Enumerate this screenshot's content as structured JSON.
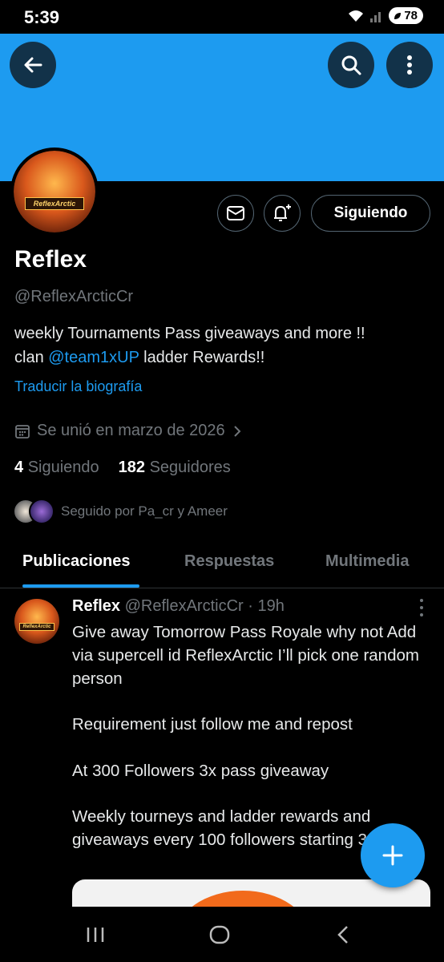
{
  "status_bar": {
    "time": "5:39",
    "battery": "78"
  },
  "header": {
    "back_icon": "arrow-left-icon",
    "search_icon": "search-icon",
    "more_icon": "more-vertical-icon"
  },
  "profile": {
    "avatar_badge": "ReflexArctic",
    "name": "Reflex",
    "handle": "@ReflexArcticCr",
    "bio_line1": "weekly Tournaments Pass giveaways and more !!",
    "bio_prefix": "clan ",
    "bio_mention": "@team1xUP",
    "bio_suffix": " ladder Rewards!!",
    "translate": "Traducir la biografía",
    "joined": "Se unió en marzo de 2026",
    "following_count": "4",
    "following_label": "Siguiendo",
    "followers_count": "182",
    "followers_label": "Seguidores",
    "followed_by": "Seguido por Pa_cr y Ameer"
  },
  "actions": {
    "message_icon": "envelope-icon",
    "notify_icon": "bell-plus-icon",
    "follow_label": "Siguiendo"
  },
  "tabs": [
    {
      "label": "Publicaciones",
      "active": true
    },
    {
      "label": "Respuestas",
      "active": false
    },
    {
      "label": "Multimedia",
      "active": false
    }
  ],
  "post": {
    "author": "Reflex",
    "handle": "@ReflexArcticCr",
    "time": "· 19h",
    "avatar_badge": "ReflexArctic",
    "text": "Give away Tomorrow Pass Royale why not Add via supercell id ReflexArctic I’ll pick one random person\n\nRequirement just follow me and repost\n\nAt 300 Followers 3x pass giveaway\n\nWeekly tourneys and ladder rewards and giveaways every 100 followers starting 300"
  },
  "fab": {
    "icon": "plus-icon"
  },
  "nav": {
    "recents_icon": "recents-icon",
    "home_icon": "home-icon",
    "back_icon": "back-chevron-icon"
  },
  "colors": {
    "accent": "#1d9bf0",
    "background": "#000000",
    "muted": "#71767b"
  }
}
